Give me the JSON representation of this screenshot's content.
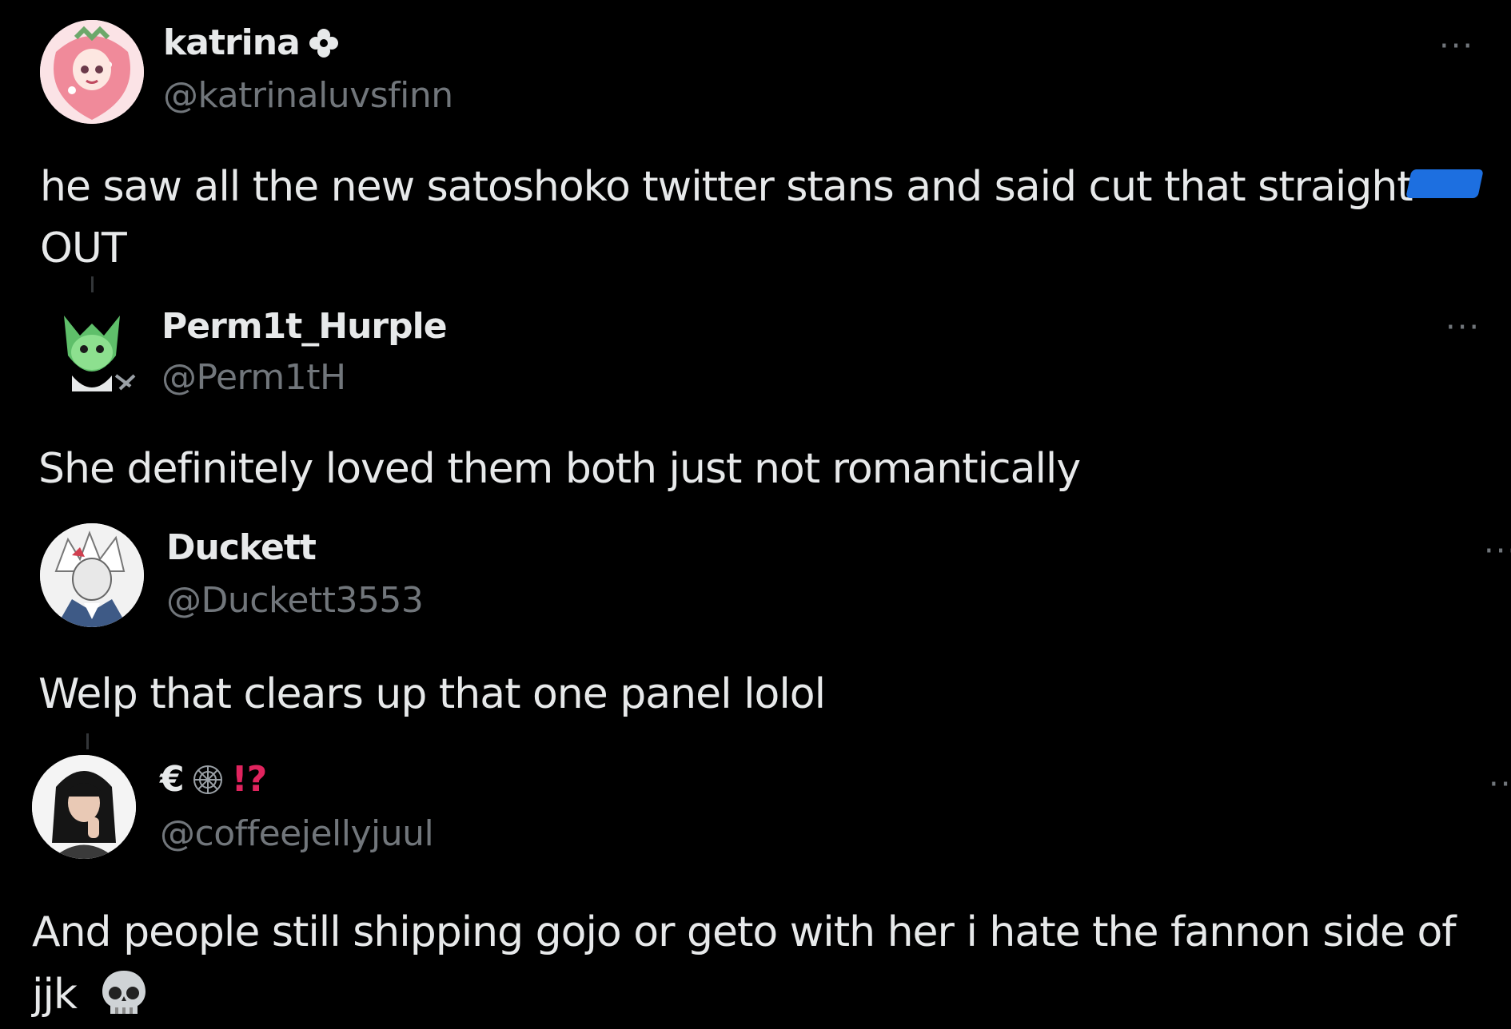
{
  "tweets": [
    {
      "name": "katrina",
      "handle": "@katrinaluvsfinn",
      "text_line1": "he saw all the new satoshoko twitter stans and said cut that straight",
      "text_line2": "OUT",
      "avatar_icon": "strawberry-anime-avatar",
      "badge_icon": "flower-badge-icon"
    },
    {
      "name": "Perm1t_Hurple",
      "handle": "@Perm1tH",
      "text_line1": "She definitely loved them both just not romantically",
      "avatar_icon": "green-creature-avatar"
    },
    {
      "name": "Duckett",
      "handle": "@Duckett3553",
      "text_line1": "Welp that clears up that one panel lolol",
      "avatar_icon": "white-haired-character-avatar"
    },
    {
      "name_prefix": "€",
      "name_suffix": "!?",
      "handle": "@coffeejellyjuul",
      "text_line1": "And people still shipping gojo or geto with her i hate the fannon side of",
      "text_line2": "jjk",
      "avatar_icon": "dark-haired-girl-avatar",
      "emoji_icon": "skull-emoji"
    }
  ],
  "more_label": "···",
  "colors": {
    "background": "#000000",
    "text": "#e7e9ea",
    "secondary": "#71767b",
    "redaction": "#1d6fe0"
  }
}
